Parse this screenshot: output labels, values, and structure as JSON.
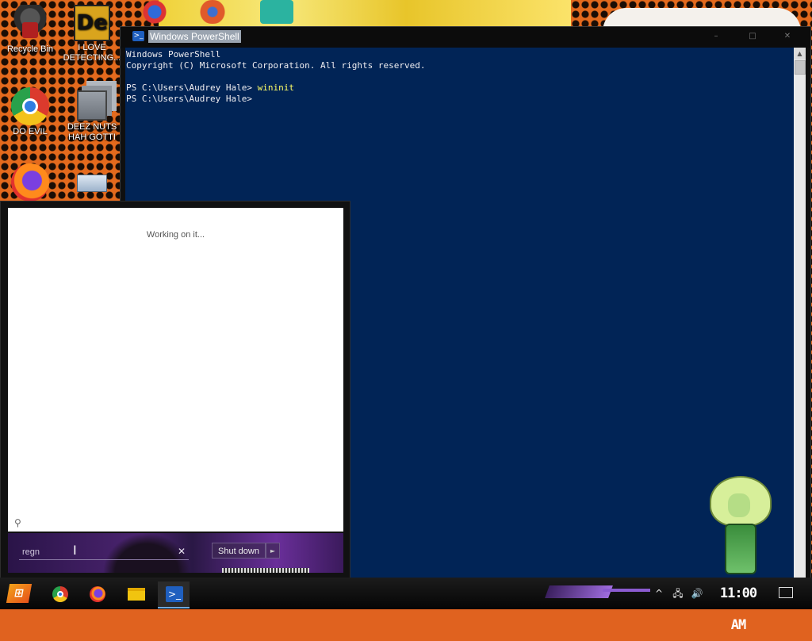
{
  "desktop": {
    "icons": [
      {
        "label": "Recycle Bin"
      },
      {
        "label": "I LOVE DETECTING..."
      },
      {
        "label": "DO EVIL"
      },
      {
        "label": "DEEZ NUTS HAH GOTTI"
      },
      {
        "label": ""
      },
      {
        "label": ""
      }
    ]
  },
  "powershell": {
    "title": "Windows PowerShell",
    "lines": [
      "Windows PowerShell",
      "Copyright (C) Microsoft Corporation. All rights reserved.",
      "",
      "PS C:\\Users\\Audrey Hale> ",
      "PS C:\\Users\\Audrey Hale> "
    ],
    "command": "wininit",
    "controls": {
      "minimize": "–",
      "maximize": "□",
      "close": "✕"
    }
  },
  "start_menu": {
    "status": "Working on it...",
    "search_value": "regn",
    "search_placeholder": "",
    "clear_label": "✕",
    "shutdown_label": "Shut down",
    "shutdown_arrow": "►"
  },
  "taskbar": {
    "apps": [
      "Chrome",
      "Firefox",
      "File Explorer",
      "Windows PowerShell"
    ],
    "active_app": "Windows PowerShell",
    "clock": "11:00 AM"
  },
  "colors": {
    "console_bg": "#012456",
    "console_text": "#eeedf0",
    "command_text": "#ffff66",
    "wallpaper": "#e46a1d"
  }
}
